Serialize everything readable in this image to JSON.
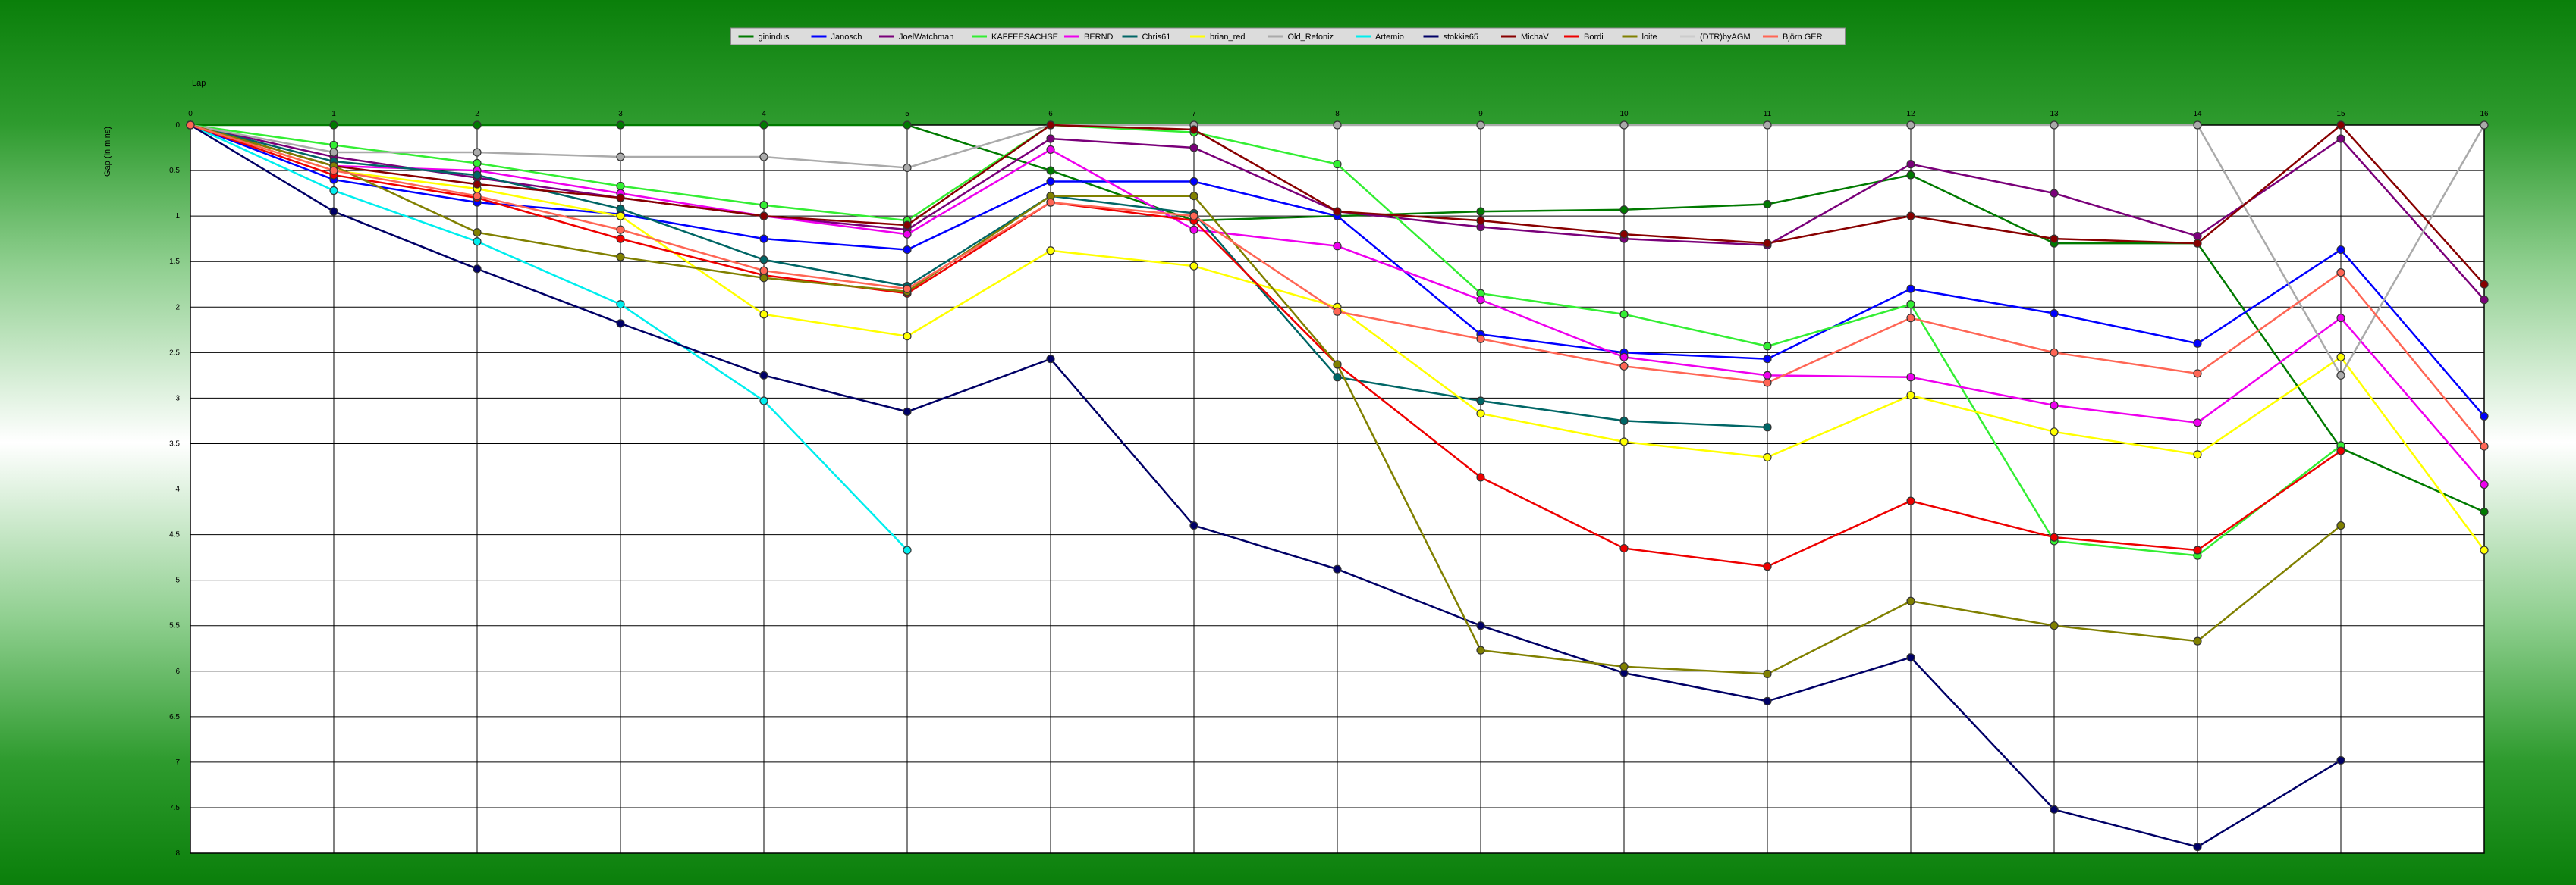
{
  "chart_data": {
    "type": "line",
    "xlabel": "Lap",
    "ylabel": "Gap (in mins)",
    "x": [
      0,
      1,
      2,
      3,
      4,
      5,
      6,
      7,
      8,
      9,
      10,
      11,
      12,
      13,
      14,
      15,
      16
    ],
    "xlim": [
      0,
      16
    ],
    "ylim": [
      0,
      8
    ],
    "y_inverted": true,
    "y_ticks": [
      "0",
      "0.5",
      "1",
      "1.5",
      "2",
      "2.5",
      "3",
      "3.5",
      "4",
      "4.5",
      "5",
      "5.5",
      "6",
      "6.5",
      "7",
      "7.5",
      "8"
    ],
    "legend_position": "top-center",
    "grid": true,
    "series": [
      {
        "name": "ginindus",
        "color": "#007a00",
        "values": [
          0,
          0,
          0,
          0,
          0,
          0,
          0.5,
          1.05,
          1.0,
          0.95,
          0.93,
          0.87,
          0.55,
          1.3,
          1.3,
          3.55,
          4.25
        ]
      },
      {
        "name": "Janosch",
        "color": "#0000ff",
        "values": [
          0,
          0.6,
          0.85,
          0.98,
          1.25,
          1.37,
          0.62,
          0.62,
          1.0,
          2.3,
          2.5,
          2.57,
          1.8,
          2.07,
          2.4,
          1.37,
          3.2
        ]
      },
      {
        "name": "JoelWatchman",
        "color": "#7a007a",
        "values": [
          0,
          0.35,
          0.58,
          0.8,
          1.0,
          1.15,
          0.15,
          0.25,
          0.95,
          1.12,
          1.25,
          1.32,
          0.43,
          0.75,
          1.22,
          0.15,
          1.92
        ]
      },
      {
        "name": "KAFFEESACHSE",
        "color": "#33ee33",
        "values": [
          0,
          0.22,
          0.42,
          0.67,
          0.88,
          1.05,
          0.0,
          0.08,
          0.43,
          1.85,
          2.08,
          2.43,
          1.97,
          4.57,
          4.73,
          3.52,
          null
        ]
      },
      {
        "name": "BERND",
        "color": "#ee00ee",
        "values": [
          0,
          0.45,
          0.5,
          0.75,
          1.0,
          1.2,
          0.27,
          1.15,
          1.33,
          1.92,
          2.55,
          2.75,
          2.77,
          3.08,
          3.27,
          2.12,
          3.95
        ]
      },
      {
        "name": "Chris61",
        "color": "#006666",
        "values": [
          0,
          0.4,
          0.55,
          0.92,
          1.48,
          1.77,
          0.78,
          0.97,
          2.77,
          3.03,
          3.25,
          3.32,
          null,
          null,
          null,
          null,
          null
        ]
      },
      {
        "name": "brian_red",
        "color": "#ffff00",
        "values": [
          0,
          0.5,
          0.7,
          1.0,
          2.08,
          2.32,
          1.38,
          1.55,
          2.0,
          3.17,
          3.48,
          3.65,
          2.97,
          3.37,
          3.62,
          2.55,
          4.67
        ]
      },
      {
        "name": "Old_Refoniz",
        "color": "#aaaaaa",
        "values": [
          0,
          0.3,
          0.3,
          0.35,
          0.35,
          0.47,
          0.0,
          0.0,
          0.0,
          0.0,
          0.0,
          0.0,
          0.0,
          0.0,
          0.0,
          2.75,
          0.0
        ]
      },
      {
        "name": "Artemio",
        "color": "#00eeee",
        "values": [
          0,
          0.72,
          1.28,
          1.97,
          3.03,
          4.67,
          null,
          null,
          null,
          null,
          null,
          null,
          null,
          null,
          null,
          null,
          null
        ]
      },
      {
        "name": "stokkie65",
        "color": "#000066",
        "values": [
          0,
          0.95,
          1.58,
          2.18,
          2.75,
          3.15,
          2.57,
          4.4,
          4.88,
          5.5,
          6.02,
          6.33,
          5.85,
          7.52,
          7.93,
          6.98,
          null
        ]
      },
      {
        "name": "MichaV",
        "color": "#880000",
        "values": [
          0,
          0.45,
          0.65,
          0.8,
          1.0,
          1.1,
          0.0,
          0.05,
          0.95,
          1.05,
          1.2,
          1.3,
          1.0,
          1.25,
          1.3,
          0.0,
          1.75
        ]
      },
      {
        "name": "Bordi",
        "color": "#ee0000",
        "values": [
          0,
          0.55,
          0.8,
          1.25,
          1.65,
          1.85,
          0.85,
          1.05,
          2.63,
          3.87,
          4.65,
          4.85,
          4.13,
          4.53,
          4.67,
          3.58,
          null
        ]
      },
      {
        "name": "loite",
        "color": "#808000",
        "values": [
          0,
          0.45,
          1.18,
          1.45,
          1.68,
          1.83,
          0.78,
          0.78,
          2.63,
          5.77,
          5.95,
          6.03,
          5.23,
          5.5,
          5.67,
          4.4,
          null
        ]
      },
      {
        "name": "(DTR)byAGM",
        "color": "#cccccc",
        "values": []
      },
      {
        "name": "Björn GER",
        "color": "#ff6655",
        "values": [
          0,
          0.5,
          0.78,
          1.15,
          1.6,
          1.8,
          0.85,
          1.0,
          2.05,
          2.35,
          2.65,
          2.83,
          2.12,
          2.5,
          2.73,
          1.62,
          3.53
        ]
      }
    ]
  }
}
